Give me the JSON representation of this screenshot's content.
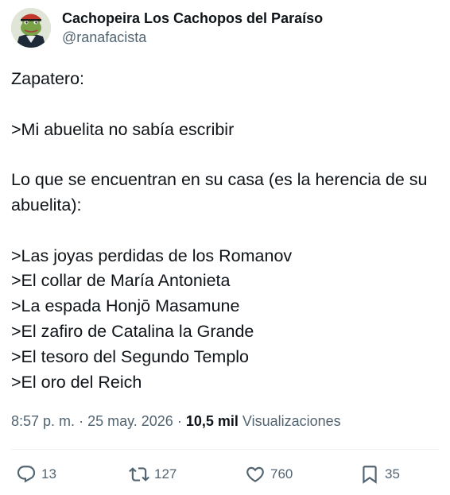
{
  "author": {
    "display_name": "Cachopeira Los Cachopos del Paraíso",
    "handle": "@ranafacista"
  },
  "tweet": {
    "lines": [
      "Zapatero:",
      "",
      ">Mi abuelita no sabía escribir",
      "",
      "Lo que se encuentran en su casa (es la herencia de su abuelita):",
      "",
      ">Las joyas perdidas de los Romanov",
      ">El collar de María Antonieta",
      ">La espada Honjō Masamune",
      ">El zafiro de Catalina la Grande",
      ">El tesoro del Segundo Templo",
      ">El oro del Reich"
    ]
  },
  "meta": {
    "time": "8:57 p. m.",
    "separator": "·",
    "date": "25 may. 2026",
    "views_count": "10,5 mil",
    "views_label": "Visualizaciones"
  },
  "actions": {
    "replies": {
      "icon": "reply-icon",
      "count": "13"
    },
    "reposts": {
      "icon": "repost-icon",
      "count": "127"
    },
    "likes": {
      "icon": "heart-icon",
      "count": "760"
    },
    "bookmarks": {
      "icon": "bookmark-icon",
      "count": "35"
    }
  },
  "colors": {
    "text_primary": "#0f1419",
    "text_secondary": "#536471",
    "divider": "#eff3f4"
  }
}
